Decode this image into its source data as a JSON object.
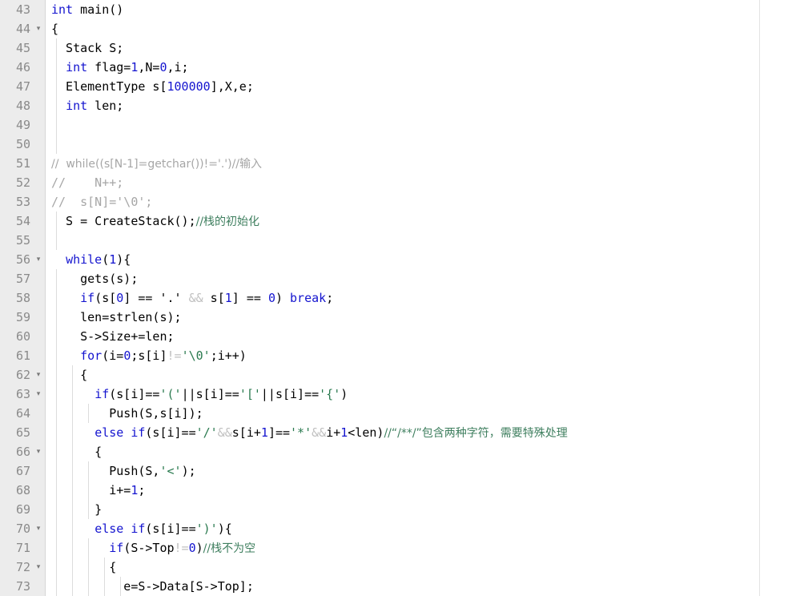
{
  "editor": {
    "language": "c",
    "first_line": 43,
    "last_line": 73,
    "colors": {
      "background": "#ffffff",
      "gutter_background": "#ececec",
      "gutter_text": "#8a8a8a",
      "keyword": "#1414cf",
      "comment": "#3f7f5f",
      "comment_disabled": "#a6a6a6",
      "char_literal": "#2a7a4f",
      "operator_faded": "#c0c0c0",
      "plain_text": "#000000",
      "indent_guide": "#dcdcdc",
      "margin_ruler": "#e3e3e3"
    },
    "fold_marker": "▾",
    "folded_lines": [
      44,
      56,
      62,
      63,
      66,
      70,
      72
    ]
  },
  "lines": [
    {
      "n": "43",
      "fold": false,
      "guides": 0,
      "tokens": [
        {
          "t": "int",
          "c": "kw"
        },
        {
          "t": " main()",
          "c": "pln"
        }
      ]
    },
    {
      "n": "44",
      "fold": true,
      "guides": 0,
      "tokens": [
        {
          "t": "{",
          "c": "pln"
        }
      ]
    },
    {
      "n": "45",
      "fold": false,
      "guides": 1,
      "tokens": [
        {
          "t": "  Stack S;",
          "c": "pln"
        }
      ]
    },
    {
      "n": "46",
      "fold": false,
      "guides": 1,
      "tokens": [
        {
          "t": "  ",
          "c": "pln"
        },
        {
          "t": "int",
          "c": "kw"
        },
        {
          "t": " flag=",
          "c": "pln"
        },
        {
          "t": "1",
          "c": "num"
        },
        {
          "t": ",N=",
          "c": "pln"
        },
        {
          "t": "0",
          "c": "num"
        },
        {
          "t": ",i;",
          "c": "pln"
        }
      ]
    },
    {
      "n": "47",
      "fold": false,
      "guides": 1,
      "tokens": [
        {
          "t": "  ElementType s[",
          "c": "pln"
        },
        {
          "t": "100000",
          "c": "num"
        },
        {
          "t": "],X,e;",
          "c": "pln"
        }
      ]
    },
    {
      "n": "48",
      "fold": false,
      "guides": 1,
      "tokens": [
        {
          "t": "  ",
          "c": "pln"
        },
        {
          "t": "int",
          "c": "kw"
        },
        {
          "t": " len;",
          "c": "pln"
        }
      ]
    },
    {
      "n": "49",
      "fold": false,
      "guides": 1,
      "tokens": []
    },
    {
      "n": "50",
      "fold": false,
      "guides": 1,
      "tokens": []
    },
    {
      "n": "51",
      "fold": false,
      "guides": 0,
      "tokens": [
        {
          "t": "//  while((s[N-1]=getchar())!='.')//输入",
          "c": "cmt-gray"
        }
      ]
    },
    {
      "n": "52",
      "fold": false,
      "guides": 0,
      "tokens": [
        {
          "t": "//    N++;",
          "c": "cmt-gray"
        }
      ]
    },
    {
      "n": "53",
      "fold": false,
      "guides": 0,
      "tokens": [
        {
          "t": "//  s[N]='\\0';",
          "c": "cmt-gray"
        }
      ]
    },
    {
      "n": "54",
      "fold": false,
      "guides": 1,
      "tokens": [
        {
          "t": "  S = CreateStack();",
          "c": "pln"
        },
        {
          "t": "//栈的初始化",
          "c": "cmt"
        }
      ]
    },
    {
      "n": "55",
      "fold": false,
      "guides": 1,
      "tokens": []
    },
    {
      "n": "56",
      "fold": true,
      "guides": 0,
      "tokens": [
        {
          "t": "  ",
          "c": "pln"
        },
        {
          "t": "while",
          "c": "kw"
        },
        {
          "t": "(",
          "c": "pln"
        },
        {
          "t": "1",
          "c": "num"
        },
        {
          "t": "){",
          "c": "pln"
        }
      ]
    },
    {
      "n": "57",
      "fold": false,
      "guides": 1,
      "tokens": [
        {
          "t": "    gets(s);",
          "c": "pln"
        }
      ]
    },
    {
      "n": "58",
      "fold": false,
      "guides": 1,
      "tokens": [
        {
          "t": "    ",
          "c": "pln"
        },
        {
          "t": "if",
          "c": "kw"
        },
        {
          "t": "(s[",
          "c": "pln"
        },
        {
          "t": "0",
          "c": "num"
        },
        {
          "t": "] == ",
          "c": "pln"
        },
        {
          "t": "'.'",
          "c": "pln"
        },
        {
          "t": " ",
          "c": "pln"
        },
        {
          "t": "&&",
          "c": "op"
        },
        {
          "t": " s[",
          "c": "pln"
        },
        {
          "t": "1",
          "c": "num"
        },
        {
          "t": "] == ",
          "c": "pln"
        },
        {
          "t": "0",
          "c": "num"
        },
        {
          "t": ") ",
          "c": "pln"
        },
        {
          "t": "break",
          "c": "kw"
        },
        {
          "t": ";",
          "c": "pln"
        }
      ]
    },
    {
      "n": "59",
      "fold": false,
      "guides": 1,
      "tokens": [
        {
          "t": "    len=strlen(s);",
          "c": "pln"
        }
      ]
    },
    {
      "n": "60",
      "fold": false,
      "guides": 1,
      "tokens": [
        {
          "t": "    S->Size+=len;",
          "c": "pln"
        }
      ]
    },
    {
      "n": "61",
      "fold": false,
      "guides": 1,
      "tokens": [
        {
          "t": "    ",
          "c": "pln"
        },
        {
          "t": "for",
          "c": "kw"
        },
        {
          "t": "(i=",
          "c": "pln"
        },
        {
          "t": "0",
          "c": "num"
        },
        {
          "t": ";s[i]",
          "c": "pln"
        },
        {
          "t": "!=",
          "c": "op"
        },
        {
          "t": "'\\0'",
          "c": "chr"
        },
        {
          "t": ";i++)",
          "c": "pln"
        }
      ]
    },
    {
      "n": "62",
      "fold": true,
      "guides": 2,
      "tokens": [
        {
          "t": "    {",
          "c": "pln"
        }
      ]
    },
    {
      "n": "63",
      "fold": true,
      "guides": 2,
      "tokens": [
        {
          "t": "      ",
          "c": "pln"
        },
        {
          "t": "if",
          "c": "kw"
        },
        {
          "t": "(s[i]==",
          "c": "pln"
        },
        {
          "t": "'('",
          "c": "chr"
        },
        {
          "t": "||",
          "c": "pln"
        },
        {
          "t": "s[i]==",
          "c": "pln"
        },
        {
          "t": "'['",
          "c": "chr"
        },
        {
          "t": "||",
          "c": "pln"
        },
        {
          "t": "s[i]==",
          "c": "pln"
        },
        {
          "t": "'{'",
          "c": "chr"
        },
        {
          "t": ")",
          "c": "pln"
        }
      ]
    },
    {
      "n": "64",
      "fold": false,
      "guides": 3,
      "tokens": [
        {
          "t": "        Push(S,s[i]);",
          "c": "pln"
        }
      ]
    },
    {
      "n": "65",
      "fold": false,
      "guides": 2,
      "tokens": [
        {
          "t": "      ",
          "c": "pln"
        },
        {
          "t": "else",
          "c": "kw"
        },
        {
          "t": " ",
          "c": "pln"
        },
        {
          "t": "if",
          "c": "kw"
        },
        {
          "t": "(s[i]==",
          "c": "pln"
        },
        {
          "t": "'/'",
          "c": "chr"
        },
        {
          "t": "&&",
          "c": "op"
        },
        {
          "t": "s[i+",
          "c": "pln"
        },
        {
          "t": "1",
          "c": "num"
        },
        {
          "t": "]==",
          "c": "pln"
        },
        {
          "t": "'*'",
          "c": "chr"
        },
        {
          "t": "&&",
          "c": "op"
        },
        {
          "t": "i+",
          "c": "pln"
        },
        {
          "t": "1",
          "c": "num"
        },
        {
          "t": "<len)",
          "c": "pln"
        },
        {
          "t": "//“/**/”包含两种字符，需要特殊处理",
          "c": "cmt"
        }
      ]
    },
    {
      "n": "66",
      "fold": true,
      "guides": 2,
      "tokens": [
        {
          "t": "      {",
          "c": "pln"
        }
      ]
    },
    {
      "n": "67",
      "fold": false,
      "guides": 3,
      "tokens": [
        {
          "t": "        Push(S,",
          "c": "pln"
        },
        {
          "t": "'<'",
          "c": "chr"
        },
        {
          "t": ");",
          "c": "pln"
        }
      ]
    },
    {
      "n": "68",
      "fold": false,
      "guides": 3,
      "tokens": [
        {
          "t": "        i+=",
          "c": "pln"
        },
        {
          "t": "1",
          "c": "num"
        },
        {
          "t": ";",
          "c": "pln"
        }
      ]
    },
    {
      "n": "69",
      "fold": false,
      "guides": 3,
      "tokens": [
        {
          "t": "      }",
          "c": "pln"
        }
      ]
    },
    {
      "n": "70",
      "fold": true,
      "guides": 2,
      "tokens": [
        {
          "t": "      ",
          "c": "pln"
        },
        {
          "t": "else",
          "c": "kw"
        },
        {
          "t": " ",
          "c": "pln"
        },
        {
          "t": "if",
          "c": "kw"
        },
        {
          "t": "(s[i]==",
          "c": "pln"
        },
        {
          "t": "')'",
          "c": "chr"
        },
        {
          "t": "){",
          "c": "pln"
        }
      ]
    },
    {
      "n": "71",
      "fold": false,
      "guides": 3,
      "tokens": [
        {
          "t": "        ",
          "c": "pln"
        },
        {
          "t": "if",
          "c": "kw"
        },
        {
          "t": "(S->Top",
          "c": "pln"
        },
        {
          "t": "!=",
          "c": "op"
        },
        {
          "t": "0",
          "c": "num"
        },
        {
          "t": ")",
          "c": "pln"
        },
        {
          "t": "//栈不为空",
          "c": "cmt"
        }
      ]
    },
    {
      "n": "72",
      "fold": true,
      "guides": 4,
      "tokens": [
        {
          "t": "        {",
          "c": "pln"
        }
      ]
    },
    {
      "n": "73",
      "fold": false,
      "guides": 5,
      "tokens": [
        {
          "t": "          e=S->Data[S->Top];",
          "c": "pln"
        }
      ]
    }
  ]
}
